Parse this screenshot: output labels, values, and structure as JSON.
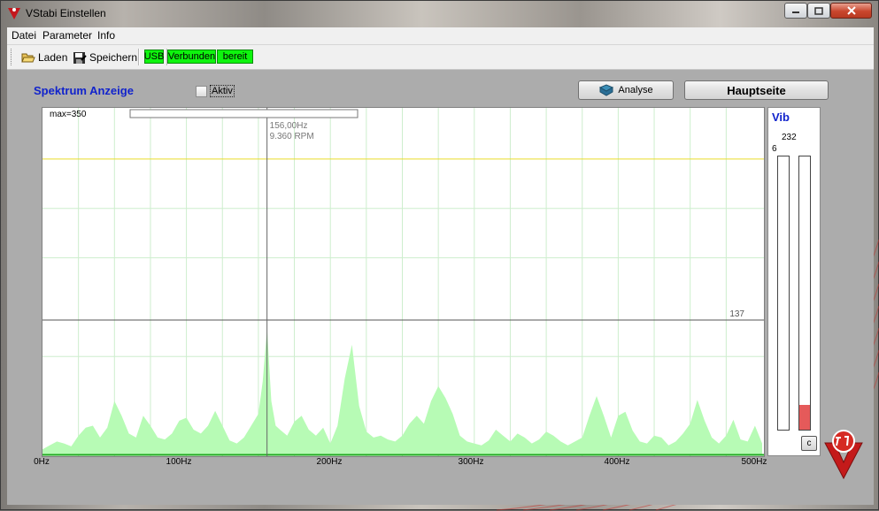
{
  "window": {
    "title": "VStabi Einstellen"
  },
  "menu": {
    "items": [
      "Datei",
      "Parameter",
      "Info"
    ]
  },
  "toolbar": {
    "load_label": "Laden",
    "save_label": "Speichern",
    "usb_label": "USB",
    "connected_label": "Verbunden",
    "ready_label": "bereit"
  },
  "panel": {
    "title": "Spektrum Anzeige",
    "aktiv_label": "Aktiv",
    "analyse_label": "Analyse",
    "main_label": "Hauptseite"
  },
  "spectrum": {
    "max_label": "max=350",
    "cursor_freq": "156,00Hz",
    "cursor_rpm": "9.360 RPM",
    "threshold_label": "137",
    "x_labels": [
      "0Hz",
      "100Hz",
      "200Hz",
      "300Hz",
      "400Hz",
      "500Hz"
    ]
  },
  "vib": {
    "title": "Vib",
    "top_value": "232",
    "side_value": "6",
    "bar_left_fraction": 0,
    "bar_right_fraction": 0.09,
    "clear_label": "c"
  },
  "colors": {
    "accent_blue": "#1123cc",
    "status_green": "#0ef40e",
    "spectrum_fill": "#b7fbb5",
    "spectrum_line": "#1faa1f",
    "threshold_yellow": "#e9dc2a",
    "vib_red": "#e55a5a"
  },
  "chart_data": {
    "type": "area",
    "x_unit": "Hz",
    "y_max": 350,
    "xlim": [
      0,
      500
    ],
    "cursor_x": 156,
    "yellow_line_y": 300,
    "threshold_y": 137,
    "x": [
      0,
      5,
      10,
      15,
      20,
      25,
      30,
      35,
      40,
      45,
      50,
      55,
      60,
      65,
      70,
      75,
      80,
      85,
      90,
      95,
      100,
      105,
      110,
      115,
      120,
      125,
      130,
      135,
      140,
      145,
      150,
      153,
      156,
      159,
      162,
      165,
      170,
      175,
      180,
      185,
      190,
      195,
      200,
      205,
      210,
      215,
      220,
      225,
      230,
      235,
      240,
      245,
      250,
      255,
      260,
      265,
      270,
      275,
      280,
      285,
      290,
      295,
      300,
      305,
      310,
      315,
      320,
      325,
      330,
      335,
      340,
      345,
      350,
      355,
      360,
      365,
      370,
      375,
      380,
      385,
      390,
      395,
      400,
      405,
      410,
      415,
      420,
      425,
      430,
      435,
      440,
      445,
      450,
      455,
      460,
      465,
      470,
      475,
      480,
      485,
      490,
      495,
      500
    ],
    "y": [
      6,
      10,
      14,
      12,
      9,
      20,
      28,
      30,
      18,
      28,
      55,
      40,
      22,
      18,
      40,
      30,
      18,
      16,
      22,
      35,
      38,
      26,
      22,
      30,
      45,
      30,
      15,
      12,
      18,
      30,
      42,
      75,
      128,
      55,
      30,
      26,
      20,
      34,
      40,
      26,
      20,
      28,
      12,
      30,
      78,
      112,
      50,
      24,
      18,
      20,
      16,
      14,
      20,
      32,
      40,
      32,
      55,
      70,
      58,
      42,
      20,
      14,
      12,
      10,
      15,
      26,
      20,
      14,
      22,
      18,
      12,
      16,
      24,
      20,
      14,
      10,
      14,
      18,
      40,
      60,
      40,
      18,
      40,
      44,
      25,
      14,
      12,
      20,
      18,
      10,
      14,
      22,
      32,
      56,
      35,
      18,
      12,
      20,
      36,
      16,
      14,
      30,
      12
    ]
  }
}
